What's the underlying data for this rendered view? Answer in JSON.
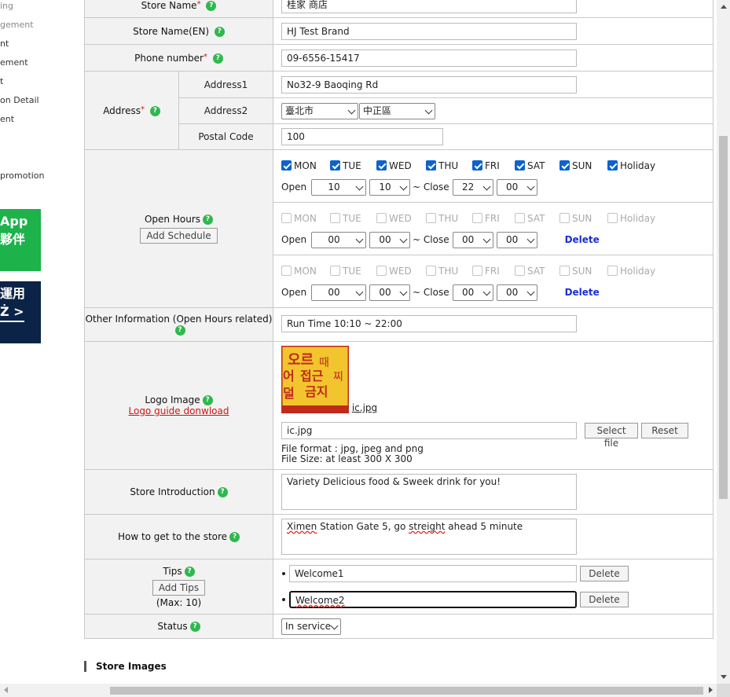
{
  "sidebar": {
    "items": [
      {
        "label": "ing",
        "dim": true
      },
      {
        "label": "gement",
        "dim": true
      },
      {
        "label": "nt",
        "dim": false
      },
      {
        "label": "ement",
        "dim": false
      },
      {
        "label": "t",
        "dim": false
      },
      {
        "label": "on Detail",
        "dim": false
      },
      {
        "label": "ent",
        "dim": false
      },
      {
        "label": " promotion",
        "dim": false
      }
    ],
    "banner_green": {
      "line1": "App",
      "line2": "夥伴"
    },
    "banner_navy": {
      "line1": "運用",
      "line2": "Ż >"
    }
  },
  "form": {
    "store_name": {
      "label": "Store Name",
      "value": "桂家 商店"
    },
    "store_name_en": {
      "label": "Store Name(EN)",
      "value": "HJ Test Brand"
    },
    "phone": {
      "label": "Phone number",
      "value": "09-6556-15417"
    },
    "address": {
      "label": "Address",
      "address1_label": "Address1",
      "address1_value": "No32-9 Baoqing Rd",
      "address2_label": "Address2",
      "city": "臺北市",
      "district": "中正區",
      "postal_label": "Postal Code",
      "postal_value": "100"
    },
    "open_hours": {
      "label": "Open Hours",
      "add_button": "Add Schedule",
      "open_label": "Open",
      "close_label": "~ Close",
      "delete_label": "Delete",
      "days": [
        "MON",
        "TUE",
        "WED",
        "THU",
        "FRI",
        "SAT",
        "SUN",
        "Holiday"
      ],
      "schedule1": {
        "open_h": "10",
        "open_m": "10",
        "close_h": "22",
        "close_m": "00"
      },
      "schedule2": {
        "open_h": "00",
        "open_m": "00",
        "close_h": "00",
        "close_m": "00"
      },
      "schedule3": {
        "open_h": "00",
        "open_m": "00",
        "close_h": "00",
        "close_m": "00"
      }
    },
    "other_info": {
      "label": "Other Information (Open Hours related)",
      "value": "Run Time 10:10 ~ 22:00"
    },
    "logo": {
      "label": "Logo Image",
      "guide_link": "Logo guide donwload",
      "file_link": "ic.jpg",
      "file_value": "ic.jpg",
      "select_button": "Select file",
      "reset_button": "Reset",
      "format_note": "File format : jpg, jpeg and png",
      "size_note": "File Size: at least 300 X 300",
      "logo_text": "오르어덜섭근금지때찌"
    },
    "intro": {
      "label": "Store Introduction",
      "value": "Variety Delicious food & Sweek drink for you!"
    },
    "directions": {
      "label": "How to get to the store",
      "w1": "Ximen",
      "w2": " Station Gate 5, go ",
      "w3": "streight",
      "w4": " ahead 5 minute"
    },
    "tips": {
      "label": "Tips",
      "add_button": "Add Tips",
      "max_note": "(Max: 10)",
      "delete_label": "Delete",
      "tip1": "Welcome1",
      "tip2": "Welcome2"
    },
    "status": {
      "label": "Status",
      "value": "In service"
    }
  },
  "section_title": "Store Images",
  "help_glyph": "?",
  "required_mark": "*"
}
